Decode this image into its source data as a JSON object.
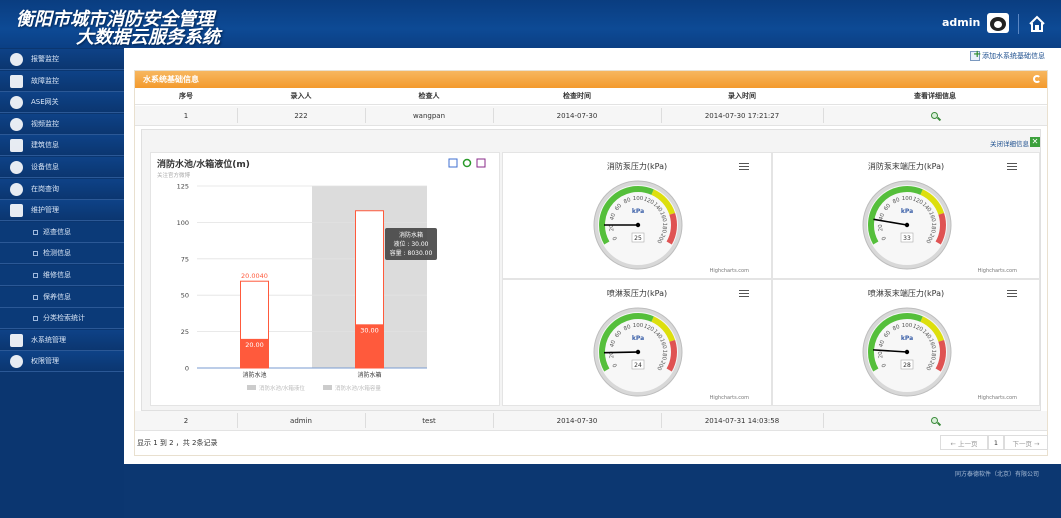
{
  "header": {
    "title_line1": "衡阳市城市消防安全管理",
    "title_line2": "大数据云服务系统",
    "user": "admin"
  },
  "sidebar": {
    "items": [
      {
        "label": "报警监控",
        "icon": "fire-alarm-icon"
      },
      {
        "label": "故障监控",
        "icon": "fault-icon"
      },
      {
        "label": "ASE网关",
        "icon": "gateway-icon"
      },
      {
        "label": "视频监控",
        "icon": "camera-icon"
      },
      {
        "label": "建筑信息",
        "icon": "building-icon"
      },
      {
        "label": "设备信息",
        "icon": "gear-icon"
      },
      {
        "label": "在岗查询",
        "icon": "search-icon"
      },
      {
        "label": "维护管理",
        "icon": "maintenance-icon"
      },
      {
        "label": "巡查信息",
        "sub": true
      },
      {
        "label": "检测信息",
        "sub": true
      },
      {
        "label": "维修信息",
        "sub": true
      },
      {
        "label": "保养信息",
        "sub": true
      },
      {
        "label": "分类检索统计",
        "sub": true
      },
      {
        "label": "水系统管理",
        "icon": "water-icon"
      },
      {
        "label": "权限管理",
        "icon": "permission-icon"
      }
    ]
  },
  "actions": {
    "add_water_system": "添加水系统基础信息",
    "close_detail": "关闭详细信息"
  },
  "panel": {
    "title": "水系统基础信息"
  },
  "table": {
    "headers": [
      "序号",
      "录入人",
      "检查人",
      "检查时间",
      "录入时间",
      "查看详细信息"
    ],
    "rows": [
      [
        "1",
        "222",
        "wangpan",
        "2014-07-30",
        "2014-07-30 17:21:27"
      ],
      [
        "2",
        "admin",
        "test",
        "2014-07-30",
        "2014-07-31 14:03:58"
      ]
    ]
  },
  "chart_data": {
    "type": "bar",
    "title": "消防水池/水箱液位(m)",
    "subtitle": "关注官方微博",
    "categories": [
      "消防水池",
      "消防水箱"
    ],
    "ylim": [
      0,
      125
    ],
    "yticks": [
      0,
      25,
      50,
      75,
      100,
      125
    ],
    "series": [
      {
        "name": "消防水池/水箱液位",
        "values": [
          20.0,
          30.0
        ],
        "labels": [
          "20.00",
          "30.00"
        ],
        "color": "#ff5a3c"
      },
      {
        "name": "消防水池/水箱容量",
        "values": [
          20.004,
          30.0
        ],
        "labels": [
          "20.0040",
          ""
        ],
        "color": "#ff5a3c"
      }
    ],
    "tooltip": {
      "title": "消防水箱",
      "line1": "液位 : 30.00",
      "line2": "容量 : 8030.00"
    },
    "legend_position": "bottom"
  },
  "gauges": [
    {
      "title": "消防泵压力(kPa)",
      "value": 25,
      "unit": "kPa"
    },
    {
      "title": "消防泵末端压力(kPa)",
      "value": 33,
      "unit": "kPa"
    },
    {
      "title": "喷淋泵压力(kPa)",
      "value": 24,
      "unit": "kPa"
    },
    {
      "title": "喷淋泵末端压力(kPa)",
      "value": 28,
      "unit": "kPa"
    }
  ],
  "gauge_ticks": [
    "0",
    "20",
    "40",
    "60",
    "80",
    "100",
    "120",
    "140",
    "160",
    "180",
    "200"
  ],
  "highcharts": "Highcharts.com",
  "footer": {
    "summary": "显示 1 到 2 ，共 2条记录",
    "prev": "← 上一页",
    "page": "1",
    "next": "下一页 →",
    "copyright": "同方泰德软件（北京）有限公司"
  },
  "colors": {
    "header_blue": "#0d4a95",
    "orange": "#f39a2c",
    "bar_red": "#ff5a3c",
    "green": "#3ca03c"
  }
}
